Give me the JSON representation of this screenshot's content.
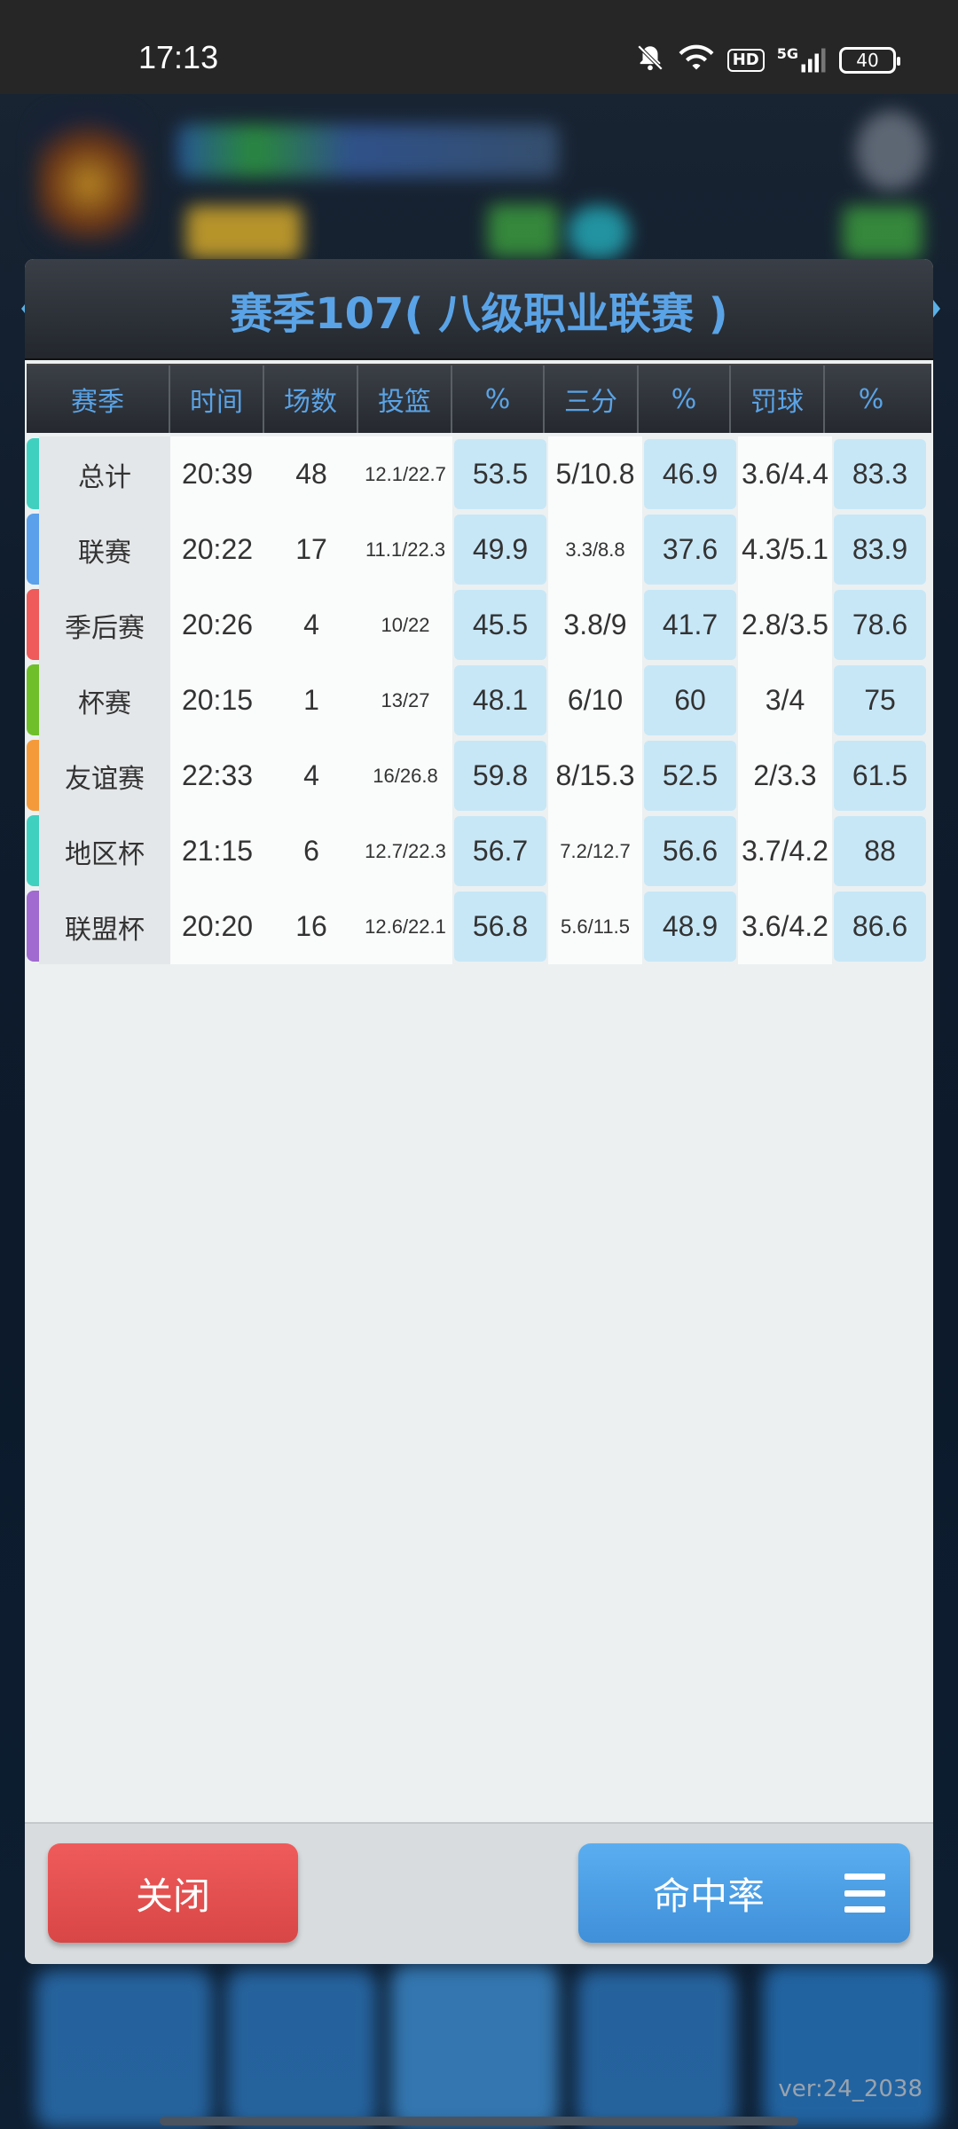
{
  "status_bar": {
    "time": "17:13",
    "icons": [
      "bell-muted-icon",
      "wifi-icon",
      "hd-icon",
      "signal-5g-icon",
      "battery-icon"
    ],
    "hd_label": "HD",
    "network_label": "5G",
    "battery_level": "40"
  },
  "background": {
    "version": "ver:24_2038"
  },
  "modal": {
    "title": "赛季107( 八级职业联赛 )",
    "columns": [
      "赛季",
      "时间",
      "场数",
      "投篮",
      "%",
      "三分",
      "%",
      "罚球",
      "%"
    ],
    "rows": [
      {
        "name": "总计",
        "color": "#40d0c0",
        "time": "20:39",
        "games": "48",
        "fg": "12.1/22.7",
        "fg_pct": "53.5",
        "three": "5/10.8",
        "three_pct": "46.9",
        "ft": "3.6/4.4",
        "ft_pct": "83.3"
      },
      {
        "name": "联赛",
        "color": "#5aa0ea",
        "time": "20:22",
        "games": "17",
        "fg": "11.1/22.3",
        "fg_pct": "49.9",
        "three": "3.3/8.8",
        "three_pct": "37.6",
        "ft": "4.3/5.1",
        "ft_pct": "83.9"
      },
      {
        "name": "季后赛",
        "color": "#ef5a5a",
        "time": "20:26",
        "games": "4",
        "fg": "10/22",
        "fg_pct": "45.5",
        "three": "3.8/9",
        "three_pct": "41.7",
        "ft": "2.8/3.5",
        "ft_pct": "78.6"
      },
      {
        "name": "杯赛",
        "color": "#6fbf2a",
        "time": "20:15",
        "games": "1",
        "fg": "13/27",
        "fg_pct": "48.1",
        "three": "6/10",
        "three_pct": "60",
        "ft": "3/4",
        "ft_pct": "75"
      },
      {
        "name": "友谊赛",
        "color": "#f59a3a",
        "time": "22:33",
        "games": "4",
        "fg": "16/26.8",
        "fg_pct": "59.8",
        "three": "8/15.3",
        "three_pct": "52.5",
        "ft": "2/3.3",
        "ft_pct": "61.5"
      },
      {
        "name": "地区杯",
        "color": "#40d0c0",
        "time": "21:15",
        "games": "6",
        "fg": "12.7/22.3",
        "fg_pct": "56.7",
        "three": "7.2/12.7",
        "three_pct": "56.6",
        "ft": "3.7/4.2",
        "ft_pct": "88"
      },
      {
        "name": "联盟杯",
        "color": "#a06ad0",
        "time": "20:20",
        "games": "16",
        "fg": "12.6/22.1",
        "fg_pct": "56.8",
        "three": "5.6/11.5",
        "three_pct": "48.9",
        "ft": "3.6/4.2",
        "ft_pct": "86.6"
      }
    ],
    "footer": {
      "close_label": "关闭",
      "hit_rate_label": "命中率"
    }
  }
}
